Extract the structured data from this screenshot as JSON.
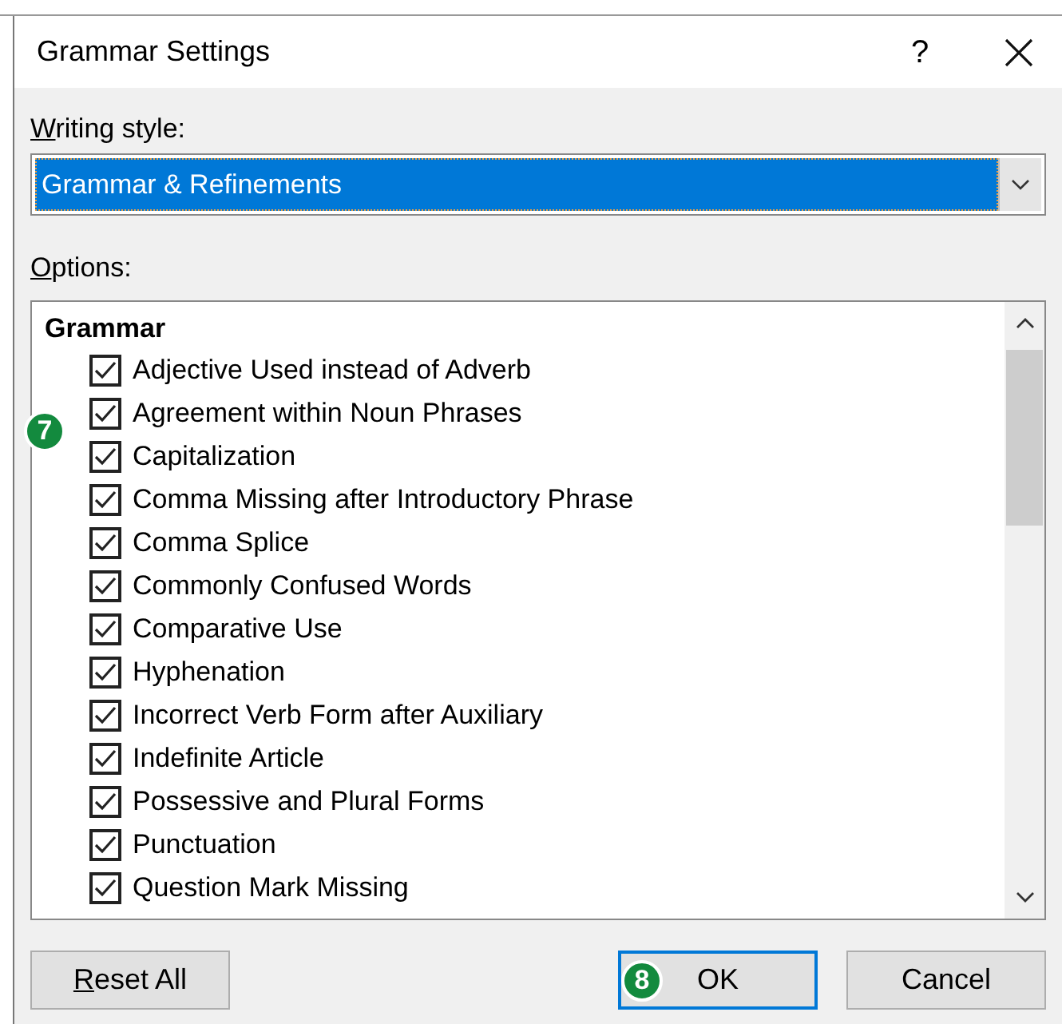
{
  "window": {
    "title": "Grammar Settings",
    "help": "?"
  },
  "writing_style": {
    "label": "Writing style:",
    "mnemonic": true,
    "value": "Grammar & Refinements"
  },
  "options": {
    "label": "Options:",
    "mnemonic": true,
    "group": "Grammar",
    "items": [
      {
        "label": "Adjective Used instead of Adverb",
        "checked": true
      },
      {
        "label": "Agreement within Noun Phrases",
        "checked": true
      },
      {
        "label": "Capitalization",
        "checked": true
      },
      {
        "label": "Comma Missing after Introductory Phrase",
        "checked": true
      },
      {
        "label": "Comma Splice",
        "checked": true
      },
      {
        "label": "Commonly Confused Words",
        "checked": true
      },
      {
        "label": "Comparative Use",
        "checked": true
      },
      {
        "label": "Hyphenation",
        "checked": true
      },
      {
        "label": "Incorrect Verb Form after Auxiliary",
        "checked": true
      },
      {
        "label": "Indefinite Article",
        "checked": true
      },
      {
        "label": "Possessive and Plural Forms",
        "checked": true
      },
      {
        "label": "Punctuation",
        "checked": true
      },
      {
        "label": "Question Mark Missing",
        "checked": true
      }
    ]
  },
  "buttons": [
    {
      "label": "Reset All",
      "mnemonic": true,
      "default": false
    },
    {
      "label": "OK",
      "mnemonic": false,
      "default": true,
      "callout": "8"
    },
    {
      "label": "Cancel",
      "mnemonic": false,
      "default": false
    }
  ],
  "callouts": [
    {
      "label": "7"
    }
  ]
}
